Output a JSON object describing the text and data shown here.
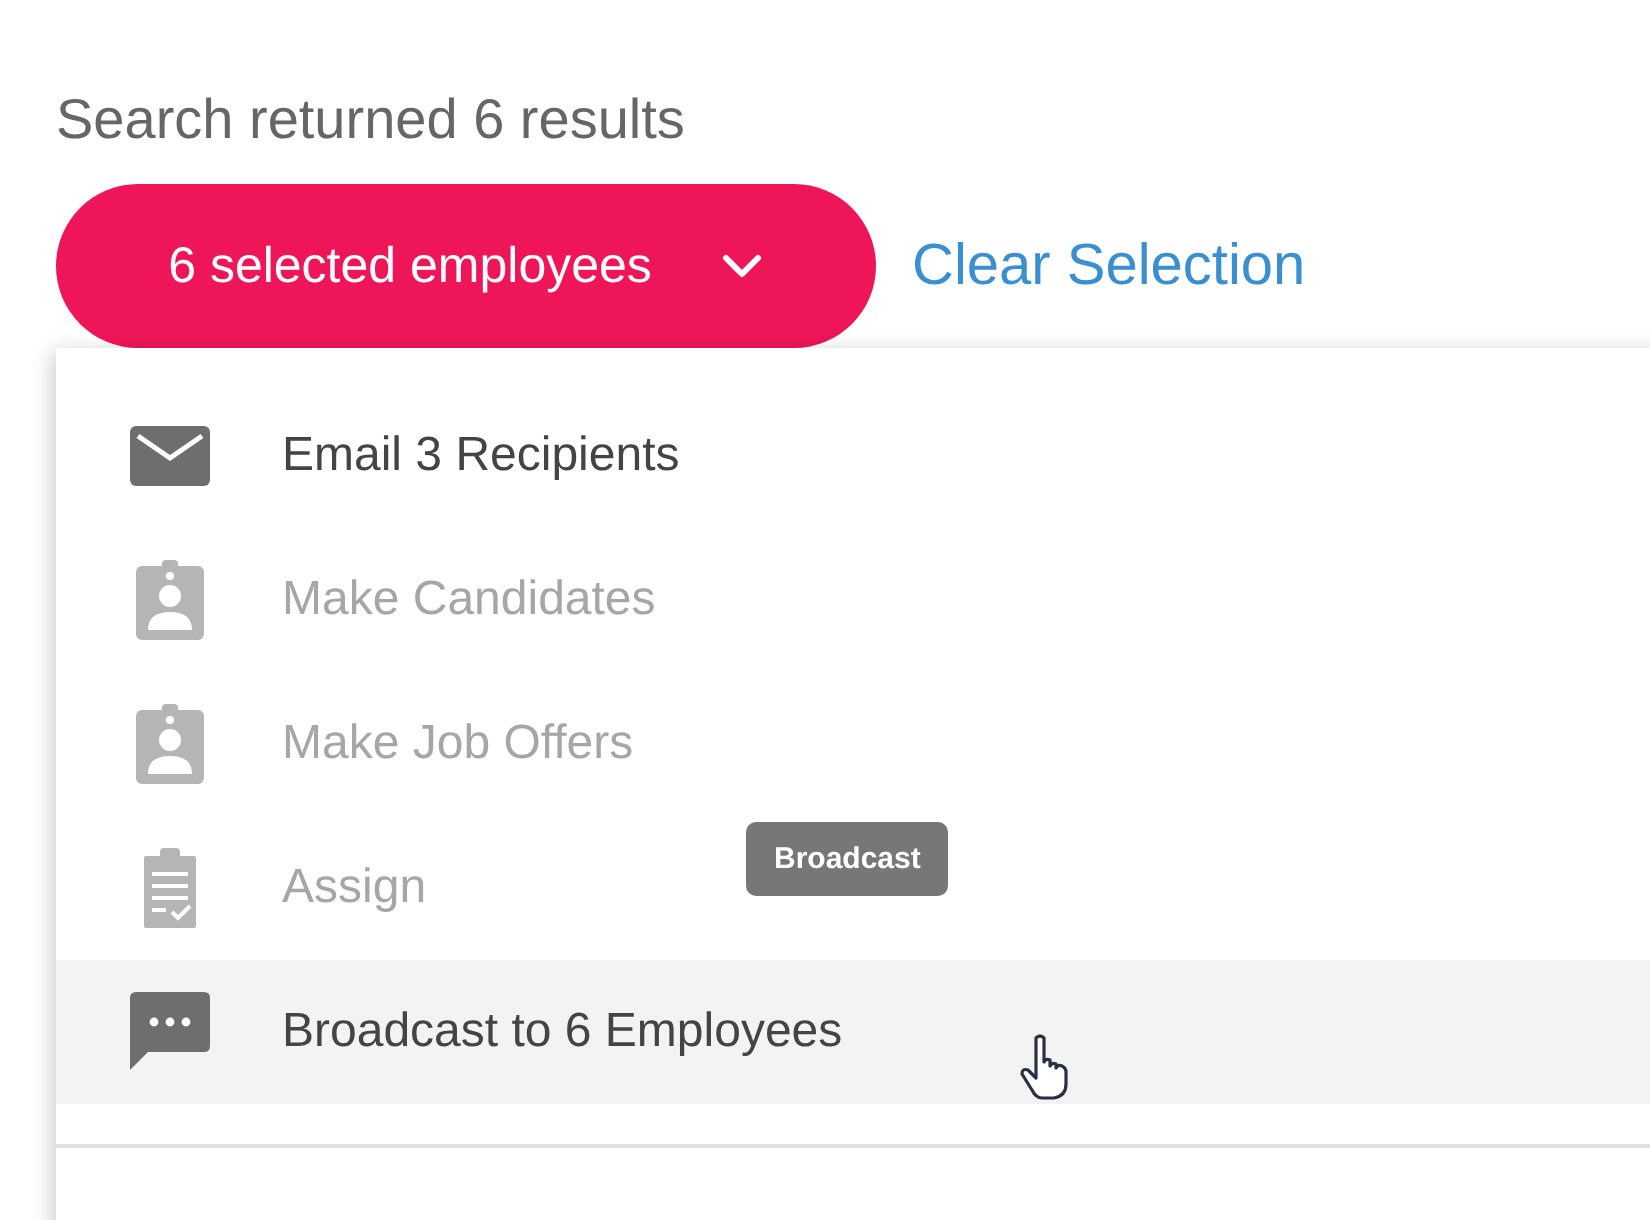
{
  "header": {
    "result_text": "Search returned 6 results"
  },
  "selection_button": {
    "label": "6 selected employees"
  },
  "clear_link": {
    "label": "Clear Selection"
  },
  "menu": {
    "items": [
      {
        "kind": "email",
        "label": "Email 3 Recipients",
        "disabled": false,
        "highlighted": false
      },
      {
        "kind": "badge",
        "label": "Make Candidates",
        "disabled": true,
        "highlighted": false
      },
      {
        "kind": "badge",
        "label": "Make Job Offers",
        "disabled": true,
        "highlighted": false
      },
      {
        "kind": "clipboard",
        "label": "Assign",
        "disabled": true,
        "highlighted": false
      },
      {
        "kind": "chat",
        "label": "Broadcast to 6 Employees",
        "disabled": false,
        "highlighted": true
      }
    ]
  },
  "tooltip": {
    "text": "Broadcast"
  }
}
